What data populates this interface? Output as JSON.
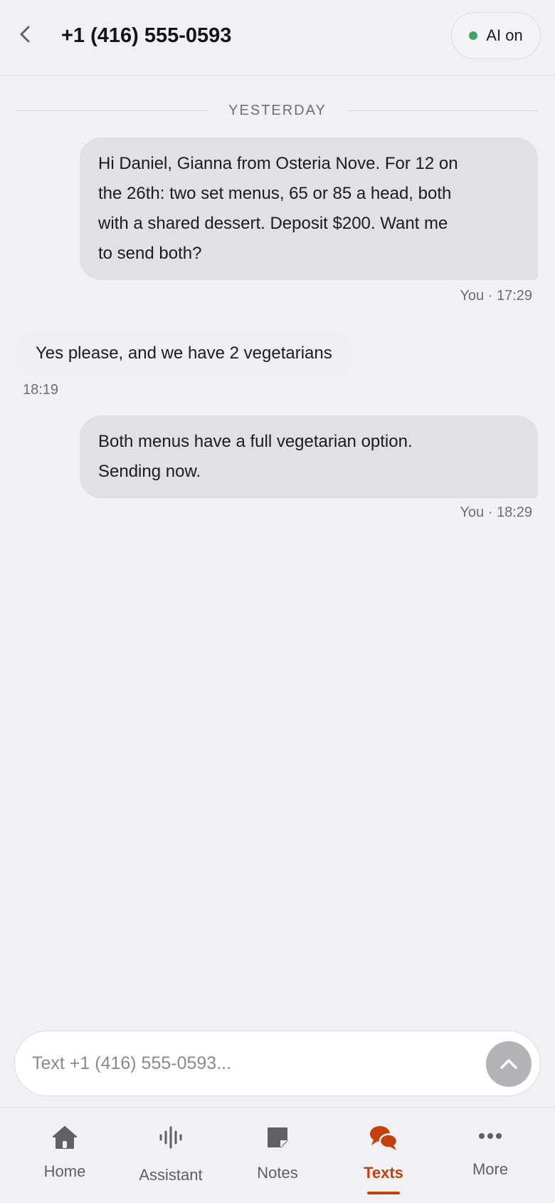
{
  "header": {
    "title": "+1 (416) 555-0593",
    "ai_status": "AI on"
  },
  "conversation": {
    "day_divider": "YESTERDAY",
    "messages": [
      {
        "direction": "outgoing",
        "lines": [
          "Hi Daniel, Gianna from Osteria Nove. For 12 on",
          "the 26th: two set menus, 65 or 85 a head, both",
          "with a shared dessert. Deposit $200. Want me",
          "to send both?"
        ],
        "meta": "You · 17:29"
      },
      {
        "direction": "incoming",
        "lines": [
          "Yes please, and we have 2 vegetarians"
        ],
        "meta": "18:19"
      },
      {
        "direction": "outgoing",
        "lines": [
          "Both menus have a full vegetarian option.",
          "Sending now."
        ],
        "meta": "You · 18:29"
      }
    ]
  },
  "composer": {
    "placeholder": "Text +1 (416) 555-0593...",
    "value": "",
    "send_icon": "chevron-up-icon"
  },
  "tabbar": {
    "items": [
      {
        "label": "Home",
        "icon": "home-icon",
        "active": false
      },
      {
        "label": "Assistant",
        "icon": "waveform-icon",
        "active": false
      },
      {
        "label": "Notes",
        "icon": "note-icon",
        "active": false
      },
      {
        "label": "Texts",
        "icon": "chat-bubbles-icon",
        "active": true
      },
      {
        "label": "More",
        "icon": "more-dots-icon",
        "active": false
      }
    ]
  },
  "colors": {
    "accent": "#c2410c",
    "ai_status_dot": "#3fa46b",
    "outgoing_bubble": "#e1e1e3",
    "background": "#f1f1f3"
  }
}
